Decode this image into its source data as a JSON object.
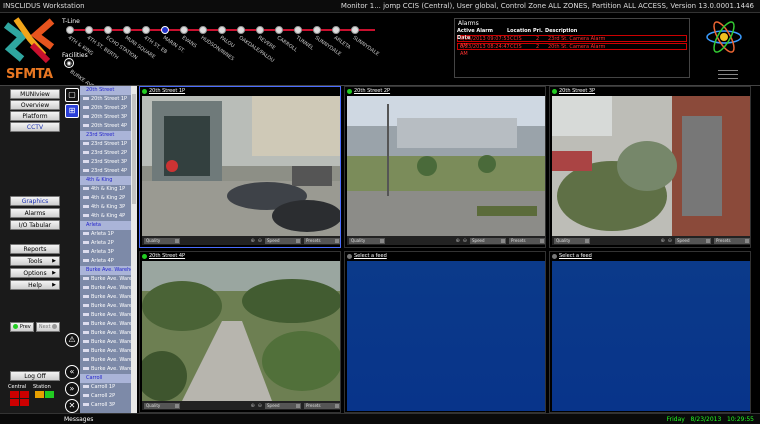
{
  "window": {
    "title": "INSCLIDUS Workstation",
    "user_info": "Monitor 1... jomp CCIS (Central), User global, Control Zone ALL ZONES, Partition ALL ACCESS, Version 13.0.0001.1446"
  },
  "header": {
    "logo_text": "SFMTA",
    "tline_label": "T-Line",
    "facilities_label": "Facilities",
    "facility_name": "BURKE AVE",
    "stations": [
      "4TH & KING",
      "4TH ST. BERTH",
      "ECHO STATION",
      "MUNI SQUARE",
      "4TH ST. EB",
      "MARIN ST.",
      "EVANS",
      "HUDSON/INNES",
      "PALOU",
      "OAKDALE/PALOU",
      "REVERE",
      "CARROLL",
      "TUNNEL",
      "SUNNYDALE",
      "ARLETA",
      "SUNNYDALE"
    ],
    "selected_station_index": 5
  },
  "alarms": {
    "title": "Alarms",
    "columns": [
      "Active Alarm Date",
      "Location",
      "Pri.",
      "Description"
    ],
    "rows": [
      {
        "date": "8/23/2013 09:07:53 AM",
        "location": "CCIS",
        "pri": "2",
        "desc": "23rd St. Camera Alarm"
      },
      {
        "date": "8/23/2013 08:24:47 AM",
        "location": "CCIS",
        "pri": "2",
        "desc": "20th St. Camera Alarm"
      }
    ]
  },
  "nav": {
    "muniview": "MUNIview",
    "overview": "Overview",
    "platform": "Platform",
    "cctv": "CCTV",
    "graphics": "Graphics",
    "alarms": "Alarms",
    "io_tabular": "I/O Tabular",
    "reports": "Reports",
    "tools": "Tools",
    "options": "Options",
    "help": "Help",
    "prev": "Prev",
    "next": "Next",
    "log_off": "Log Off",
    "central": "Central",
    "station": "Station"
  },
  "camera_list": [
    {
      "label": "20th Street",
      "group": true
    },
    {
      "label": "20th Street 1P",
      "group": false
    },
    {
      "label": "20th Street 2P",
      "group": false
    },
    {
      "label": "20th Street 3P",
      "group": false
    },
    {
      "label": "20th Street 4P",
      "group": false
    },
    {
      "label": "23rd Street",
      "group": true
    },
    {
      "label": "23rd Street 1P",
      "group": false
    },
    {
      "label": "23rd Street 2P",
      "group": false
    },
    {
      "label": "23rd Street 3P",
      "group": false
    },
    {
      "label": "23rd Street 4P",
      "group": false
    },
    {
      "label": "4th & King",
      "group": true
    },
    {
      "label": "4th & King 1P",
      "group": false
    },
    {
      "label": "4th & King 2P",
      "group": false
    },
    {
      "label": "4th & King 3P",
      "group": false
    },
    {
      "label": "4th & King 4P",
      "group": false
    },
    {
      "label": "Arleta",
      "group": true
    },
    {
      "label": "Arleta 1P",
      "group": false
    },
    {
      "label": "Arleta 2P",
      "group": false
    },
    {
      "label": "Arleta 3P",
      "group": false
    },
    {
      "label": "Arleta 4P",
      "group": false
    },
    {
      "label": "Burke Ave. Warehouse",
      "group": true
    },
    {
      "label": "Burke Ave. Ware",
      "group": false
    },
    {
      "label": "Burke Ave. Ware",
      "group": false
    },
    {
      "label": "Burke Ave. Ware",
      "group": false
    },
    {
      "label": "Burke Ave. Ware",
      "group": false
    },
    {
      "label": "Burke Ave. Ware",
      "group": false
    },
    {
      "label": "Burke Ave. Ware",
      "group": false
    },
    {
      "label": "Burke Ave. Ware",
      "group": false
    },
    {
      "label": "Burke Ave. Ware",
      "group": false
    },
    {
      "label": "Burke Ave. Ware",
      "group": false
    },
    {
      "label": "Burke Ave. Ware",
      "group": false
    },
    {
      "label": "Burke Ave. Ware",
      "group": false
    },
    {
      "label": "Carroll",
      "group": true
    },
    {
      "label": "Carroll 1P",
      "group": false
    },
    {
      "label": "Carroll 2P",
      "group": false
    },
    {
      "label": "Carroll 3P",
      "group": false
    }
  ],
  "tiles": [
    {
      "caption": "20th Street 1P",
      "scene": "building",
      "active": true
    },
    {
      "caption": "20th Street 2P",
      "scene": "street",
      "active": true
    },
    {
      "caption": "20th Street 3P",
      "scene": "courtyard",
      "active": true
    },
    {
      "caption": "20th Street 4P",
      "scene": "garden",
      "active": true
    },
    {
      "caption": "Select a feed",
      "scene": "empty",
      "active": false
    },
    {
      "caption": "Select a feed",
      "scene": "empty",
      "active": false
    }
  ],
  "tile_controls": {
    "quality": "Quality",
    "speed": "Speed",
    "presets": "Presets"
  },
  "status": {
    "messages": "Messages",
    "day": "Friday",
    "date": "8/23/2013",
    "time": "10:29:55"
  },
  "colors": {
    "alarm_red": "#ff3030",
    "accent_blue": "#2a3fd8",
    "feed_blue": "#0b3a8a",
    "ok_green": "#22cc22"
  }
}
